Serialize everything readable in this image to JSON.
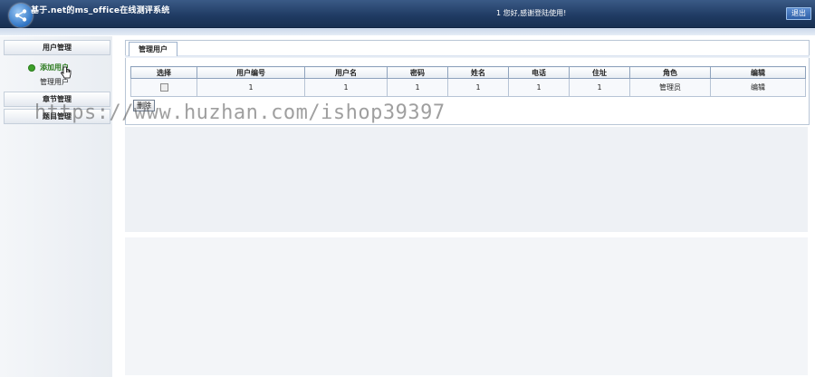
{
  "app": {
    "title": "基于.net的ms_office在线测评系统",
    "welcome": "1 您好,感谢登陆使用!",
    "logout_label": "退出"
  },
  "sidebar": {
    "sections": [
      {
        "title": "用户管理",
        "items": [
          "添加用户",
          "管理用户"
        ]
      },
      {
        "title": "章节管理",
        "items": []
      },
      {
        "title": "题目管理",
        "items": []
      }
    ],
    "active_item": "添加用户"
  },
  "main": {
    "tab_label": "管理用户",
    "table": {
      "headers": [
        "选择",
        "用户编号",
        "用户名",
        "密码",
        "姓名",
        "电话",
        "住址",
        "角色",
        "编辑"
      ],
      "rows": [
        [
          "",
          "1",
          "1",
          "1",
          "1",
          "1",
          "1",
          "管理员",
          "编辑"
        ]
      ]
    },
    "delete_label": "删除"
  },
  "watermark": "https://www.huzhan.com/ishop39397",
  "colors": {
    "topbar": "#1f3a62",
    "active_item": "#2c7a1f",
    "accent": "#3da12a"
  }
}
